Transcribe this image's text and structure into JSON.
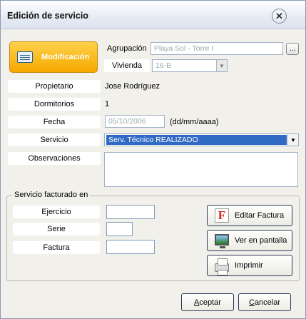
{
  "window": {
    "title": "Edición de servicio"
  },
  "mode": {
    "label": "Modificación"
  },
  "form": {
    "agrupacion_label": "Agrupación",
    "agrupacion_value": "Playa Sol - Torre I",
    "browse_label": "...",
    "vivienda_label": "Vivienda",
    "vivienda_value": "16-B",
    "propietario_label": "Propietario",
    "propietario_value": "Jose Rodríguez",
    "dormitorios_label": "Dormitorios",
    "dormitorios_value": "1",
    "fecha_label": "Fecha",
    "fecha_value": "05/10/2006",
    "fecha_hint": "(dd/mm/aaaa)",
    "servicio_label": "Servicio",
    "servicio_value": "Serv. Técnico REALIZADO",
    "observaciones_label": "Observaciones",
    "observaciones_value": ""
  },
  "billing": {
    "legend": "Servicio facturado en",
    "ejercicio_label": "Ejercicio",
    "serie_label": "Serie",
    "factura_label": "Factura",
    "ejercicio_value": "",
    "serie_value": "",
    "factura_value": "",
    "editar_factura_label": "Editar Factura",
    "editar_factura_icon": "F",
    "ver_pantalla_label": "Ver en pantalla",
    "imprimir_label": "Imprimir"
  },
  "footer": {
    "aceptar_underlined": "A",
    "aceptar_rest": "ceptar",
    "cancelar_underlined": "C",
    "cancelar_rest": "ancelar"
  },
  "icons": {
    "close": "close-icon",
    "mode": "form-edit-icon",
    "editar_factura": "invoice-f-icon",
    "ver_pantalla": "monitor-icon",
    "imprimir": "printer-icon"
  },
  "colors": {
    "badge": "#f5a800",
    "selection": "#316ac5",
    "invoice_icon": "#d21111"
  }
}
